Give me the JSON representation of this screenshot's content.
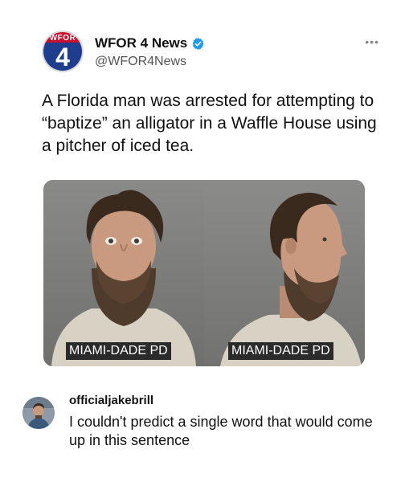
{
  "tweet": {
    "logo": {
      "top_text": "WFOR",
      "number": "4"
    },
    "account_name": "WFOR 4 News",
    "handle": "@WFOR4News",
    "more_icon": "more-dots-icon",
    "verified_icon": "verified-badge-icon",
    "text": "A Florida man was arrested for attempting to “baptize” an alligator in a Waffle House using a pitcher of iced tea.",
    "photo": {
      "left_label": "MIAMI-DADE PD",
      "right_label": "MIAMI-DADE PD"
    }
  },
  "comment": {
    "username": "officialjakebrill",
    "text": "I couldn't predict a single word that would come up in this sentence"
  },
  "colors": {
    "logo_red": "#c8102e",
    "logo_blue": "#1f3d8f",
    "verified_blue": "#1d9bf0"
  }
}
